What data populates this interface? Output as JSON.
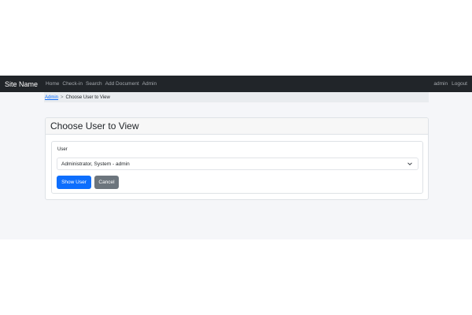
{
  "navbar": {
    "brand": "Site Name",
    "links": [
      "Home",
      "Check-in",
      "Search",
      "Add Document",
      "Admin"
    ],
    "right_links": [
      "admin",
      "Logout"
    ]
  },
  "breadcrumb": {
    "parent": "Admin",
    "separator": ">",
    "current": "Choose User to View"
  },
  "card": {
    "title": "Choose User to View",
    "form": {
      "user_label": "User",
      "user_value": "Administrator, System - admin",
      "submit_label": "Show User",
      "cancel_label": "Cancel"
    }
  },
  "colors": {
    "navbar_bg": "#212529",
    "primary": "#0d6efd",
    "secondary": "#6c757d"
  }
}
